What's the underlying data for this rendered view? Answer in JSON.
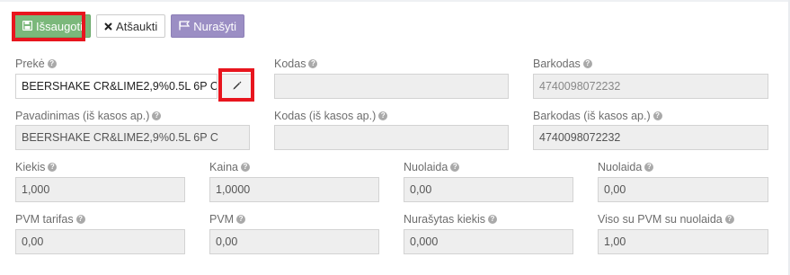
{
  "toolbar": {
    "save_label": "Išsaugoti",
    "cancel_label": "Atšaukti",
    "writeoff_label": "Nurašyti"
  },
  "help_mark": "?",
  "fields": {
    "preke": {
      "label": "Prekė",
      "value": "BEERSHAKE CR&LIME2,9%0.5L 6P C"
    },
    "kodas": {
      "label": "Kodas",
      "value": ""
    },
    "barkodas": {
      "label": "Barkodas",
      "value": "",
      "placeholder": "4740098072232"
    },
    "pavadinimas": {
      "label": "Pavadinimas (iš kasos ap.)",
      "value": "BEERSHAKE CR&LIME2,9%0.5L 6P C"
    },
    "kodas_kasos": {
      "label": "Kodas (iš kasos ap.)",
      "value": ""
    },
    "barkodas_kasos": {
      "label": "Barkodas (iš kasos ap.)",
      "value": "4740098072232"
    },
    "kiekis": {
      "label": "Kiekis",
      "value": "1,000"
    },
    "kaina": {
      "label": "Kaina",
      "value": "1,0000"
    },
    "nuolaida1": {
      "label": "Nuolaida",
      "value": "0,00"
    },
    "nuolaida2": {
      "label": "Nuolaida",
      "value": "0,00"
    },
    "pvm_tarifas": {
      "label": "PVM tarifas",
      "value": "0,00"
    },
    "pvm": {
      "label": "PVM",
      "value": "0,00"
    },
    "nurasytas_kiekis": {
      "label": "Nurašytas kiekis",
      "value": "0,000"
    },
    "viso": {
      "label": "Viso su PVM su nuolaida",
      "value": "1,00"
    }
  },
  "colors": {
    "save": "#7bb87b",
    "writeoff": "#9b8ec4",
    "highlight": "#e8151e"
  }
}
